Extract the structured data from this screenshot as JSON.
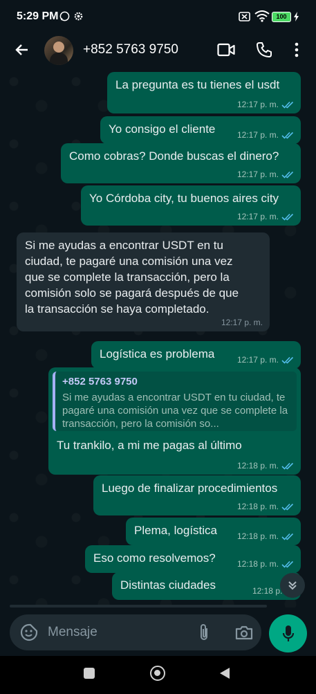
{
  "status_bar": {
    "time": "5:29 PM",
    "battery": "100"
  },
  "header": {
    "contact": "+852 5763 9750"
  },
  "messages": [
    {
      "text": "La pregunta es tu tienes el usdt",
      "time": "12:17 p. m."
    },
    {
      "text": "Yo consigo el cliente",
      "time": "12:17 p. m."
    },
    {
      "text": "Como cobras? Donde buscas el dinero?",
      "time": "12:17 p. m."
    },
    {
      "text": "Yo Córdoba city, tu buenos aires city",
      "time": "12:17 p. m."
    },
    {
      "text": "Si me ayudas a encontrar USDT en tu\nciudad, te pagaré una comisión una vez\nque se complete la transacción, pero la\ncomisión solo se pagará después de que\nla transacción se haya completado.",
      "time": "12:17 p. m."
    },
    {
      "text": "Logística es problema",
      "time": "12:17 p. m."
    },
    {
      "quote_name": "+852 5763 9750",
      "quote_text": "Si me ayudas a encontrar USDT en tu ciudad, te pagaré una comisión una vez que se complete la transacción, pero la comisión so...",
      "text": "Tu trankilo, a mi me pagas al último",
      "time": "12:18 p. m."
    },
    {
      "text": "Luego de finalizar procedimientos",
      "time": "12:18 p. m."
    },
    {
      "text": "Plema, logística",
      "time": "12:18 p. m."
    },
    {
      "text": "Eso como resolvemos?",
      "time": "12:18 p. m."
    },
    {
      "text": "Distintas ciudades",
      "time": "12:18 p. m."
    }
  ],
  "composer": {
    "placeholder": "Mensaje"
  },
  "colors": {
    "outgoing": "#005c4b",
    "incoming": "#202c33",
    "accent": "#00a884",
    "read_ticks": "#53bdeb"
  }
}
